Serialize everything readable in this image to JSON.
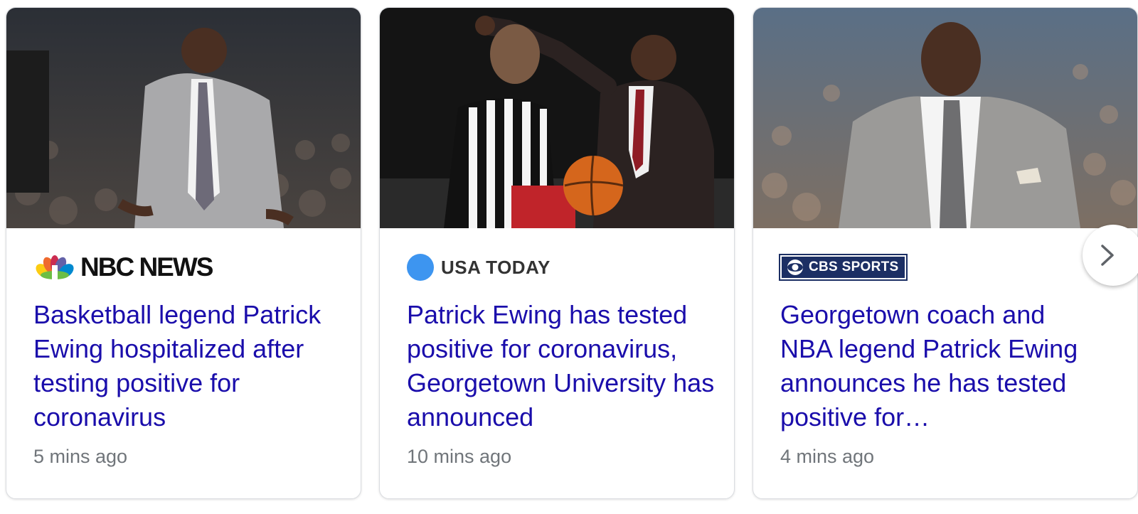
{
  "cards": [
    {
      "source": "NBC NEWS",
      "source_logo": "nbc-peacock-icon",
      "headline": "Basketball legend Patrick Ewing hospitalized after testing positive for coronavirus",
      "time": "5 mins ago"
    },
    {
      "source": "USA TODAY",
      "source_logo": "usa-today-dot-icon",
      "headline": "Patrick Ewing has tested positive for coronavirus, Georgetown University has announced",
      "time": "10 mins ago"
    },
    {
      "source": "CBS SPORTS",
      "source_logo": "cbs-eye-icon",
      "headline": "Georgetown coach and NBA legend Patrick Ewing announces he has tested positive for…",
      "time": "4 mins ago"
    }
  ],
  "carousel": {
    "next_icon": "chevron-right-icon"
  },
  "colors": {
    "headline_link": "#1a0dab",
    "timestamp": "#70757a",
    "card_border": "#dadce0",
    "usa_today_blue": "#3d95f0",
    "cbs_navy": "#1c2f64"
  }
}
